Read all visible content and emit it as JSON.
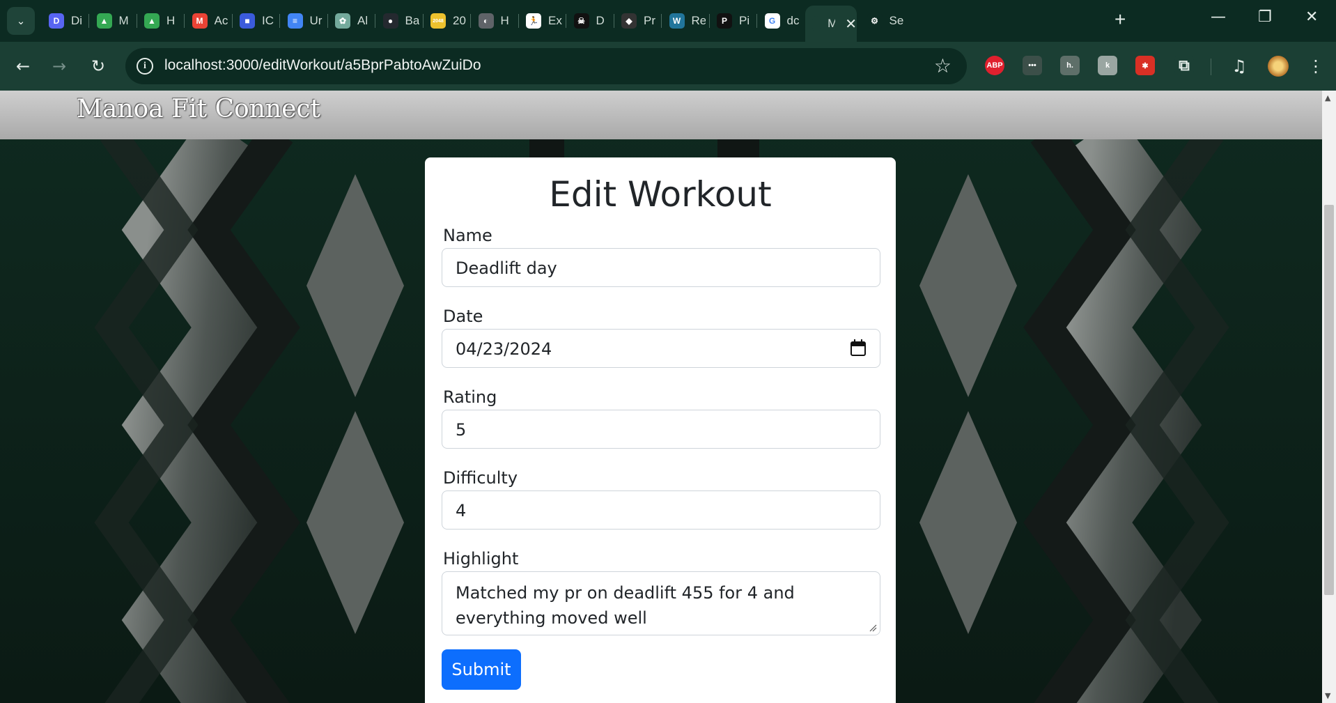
{
  "browser": {
    "tabs": [
      {
        "title": "Di",
        "icon": "discord-icon",
        "color": "#5865f2",
        "glyph": "D"
      },
      {
        "title": "M",
        "icon": "google-drive-icon",
        "color": "#34a853",
        "glyph": "▲"
      },
      {
        "title": "H",
        "icon": "google-drive-icon",
        "color": "#34a853",
        "glyph": "▲"
      },
      {
        "title": "Ac",
        "icon": "gmail-icon",
        "color": "#ea4335",
        "glyph": "M"
      },
      {
        "title": "IC",
        "icon": "blue-square-icon",
        "color": "#3b5bdb",
        "glyph": "■"
      },
      {
        "title": "Ur",
        "icon": "google-docs-icon",
        "color": "#4285f4",
        "glyph": "≡"
      },
      {
        "title": "Al",
        "icon": "chatgpt-icon",
        "color": "#74aa9c",
        "glyph": "✿"
      },
      {
        "title": "Ba",
        "icon": "github-icon",
        "color": "#24292f",
        "glyph": "●"
      },
      {
        "title": "20",
        "icon": "game-2048-icon",
        "color": "#edc22e",
        "glyph": "2048"
      },
      {
        "title": "H",
        "icon": "globe-icon",
        "color": "#5f6368",
        "glyph": "◐"
      },
      {
        "title": "Ex",
        "icon": "runner-icon",
        "color": "#ffffff",
        "glyph": "🏃"
      },
      {
        "title": "D",
        "icon": "skull-icon",
        "color": "#111111",
        "glyph": "☠"
      },
      {
        "title": "Pr",
        "icon": "mask-icon",
        "color": "#333333",
        "glyph": "◆"
      },
      {
        "title": "Re",
        "icon": "wordpress-icon",
        "color": "#21759b",
        "glyph": "W"
      },
      {
        "title": "Pi",
        "icon": "pi-icon",
        "color": "#111111",
        "glyph": "P"
      },
      {
        "title": "dc",
        "icon": "google-icon",
        "color": "#ffffff",
        "glyph": "G"
      },
      {
        "title": "M",
        "icon": "site-icon",
        "color": "#1b3f34",
        "glyph": ""
      },
      {
        "title": "Se",
        "icon": "gear-icon",
        "color": "#0c2b22",
        "glyph": "⚙"
      }
    ],
    "url": "localhost:3000/editWorkout/a5BprPabtoAwZuiDo",
    "extensions": [
      {
        "name": "adblock-plus-icon",
        "label": "ABP",
        "color": "#e0202e"
      },
      {
        "name": "more-dots-icon",
        "label": "•••",
        "color": "#3c4f49"
      },
      {
        "name": "honey-icon",
        "label": "h.",
        "color": "#5e6f69"
      },
      {
        "name": "extension-k-icon",
        "label": "k",
        "color": "#9aa6a2"
      },
      {
        "name": "extension-red-icon",
        "label": "✱",
        "color": "#d93025"
      },
      {
        "name": "puzzle-icon",
        "label": "⧉",
        "color": "#1b3f34"
      }
    ]
  },
  "site": {
    "brand": "Manoa Fit Connect"
  },
  "form": {
    "title": "Edit Workout",
    "name_label": "Name",
    "name_value": "Deadlift day",
    "date_label": "Date",
    "date_value": "04/23/2024",
    "rating_label": "Rating",
    "rating_value": "5",
    "difficulty_label": "Difficulty",
    "difficulty_value": "4",
    "highlight_label": "Highlight",
    "highlight_value": "Matched my pr on deadlift 455 for 4 and everything moved well",
    "submit_label": "Submit",
    "submit_color": "#0d6efd"
  }
}
